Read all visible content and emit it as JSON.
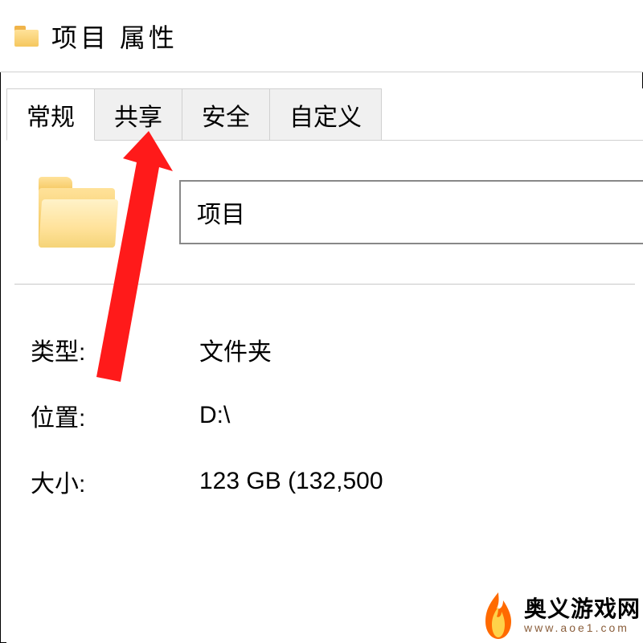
{
  "window": {
    "title": "项目 属性"
  },
  "tabs": [
    {
      "label": "常规",
      "active": true
    },
    {
      "label": "共享",
      "active": false
    },
    {
      "label": "安全",
      "active": false
    },
    {
      "label": "自定义",
      "active": false
    }
  ],
  "general": {
    "name_value": "项目",
    "rows": [
      {
        "label": "类型:",
        "value": "文件夹"
      },
      {
        "label": "位置:",
        "value": "D:\\"
      },
      {
        "label": "大小:",
        "value": "123 GB (132,500"
      }
    ]
  },
  "watermark": {
    "name": "奥义游戏网",
    "url": "www.aoe1.com"
  },
  "icons": {
    "titlebar_folder": "folder-icon",
    "big_folder": "folder-icon"
  }
}
